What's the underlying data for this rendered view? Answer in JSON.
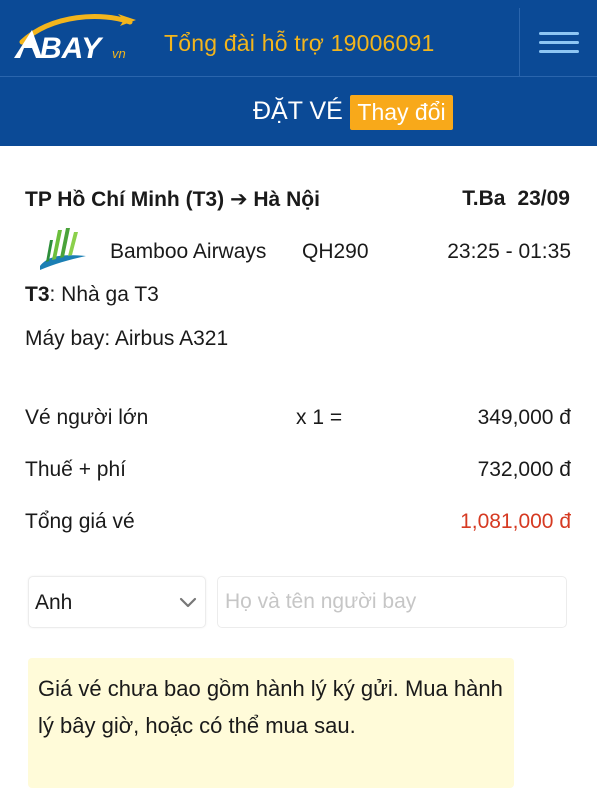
{
  "header": {
    "logo_text": "BAY",
    "logo_suffix": "vn",
    "hotline": "Tổng đài hỗ trợ 19006091",
    "menu_icon": "hamburger-menu-icon"
  },
  "subheader": {
    "title": "ĐẶT VÉ",
    "change_label": "Thay đổi"
  },
  "flight": {
    "route_from": "TP Hồ Chí Minh (T3)",
    "route_arrow": "➔",
    "route_to": "Hà Nội",
    "weekday": "T.Ba",
    "date": "23/09",
    "airline": "Bamboo Airways",
    "flight_number": "QH290",
    "time": "23:25 - 01:35",
    "terminal_code": "T3",
    "terminal_label": ": Nhà ga T3",
    "aircraft": "Máy bay: Airbus A321"
  },
  "pricing": {
    "adult_label": "Vé người lớn",
    "adult_multiplier": "x 1 =",
    "adult_value": "349,000 đ",
    "tax_label": "Thuế + phí",
    "tax_value": "732,000 đ",
    "total_label": "Tổng giá vé",
    "total_value": "1,081,000 đ"
  },
  "passenger": {
    "title_value": "Anh",
    "name_placeholder": "Họ và tên người bay",
    "name_value": ""
  },
  "notice": {
    "text": "Giá vé chưa bao gồm hành lý ký gửi. Mua hành lý bây giờ, hoặc có thể mua sau."
  },
  "colors": {
    "header_bg": "#0b4a96",
    "accent_orange": "#f8a91a",
    "hotline_yellow": "#f3b51c",
    "total_red": "#d63a22",
    "notice_bg": "#fffbd9"
  }
}
